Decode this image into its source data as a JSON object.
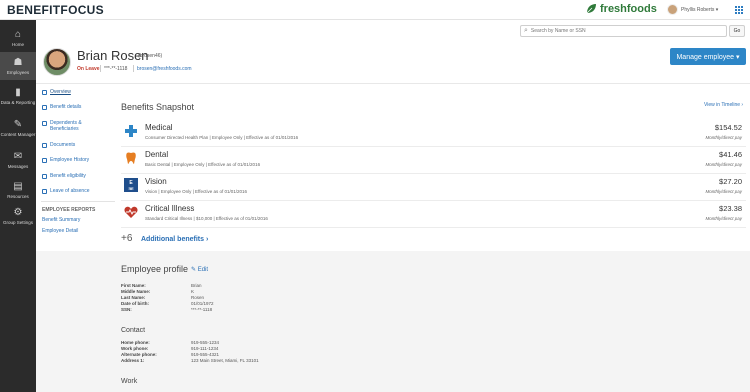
{
  "app": {
    "brand": "BENEFITFOCUS",
    "client_name": "freshfoods",
    "user_name": "Phyllis Roberts ▾",
    "search_placeholder": "Search by Name or SSN",
    "go_label": "Go"
  },
  "leftnav": [
    {
      "label": "Home",
      "icon": "home-icon",
      "glyph": "⌂"
    },
    {
      "label": "Employees",
      "icon": "employees-icon",
      "glyph": "☗",
      "active": true
    },
    {
      "label": "Data & Reporting",
      "icon": "chart-icon",
      "glyph": "▮"
    },
    {
      "label": "Content Manager",
      "icon": "pencil-icon",
      "glyph": "✎"
    },
    {
      "label": "Messages",
      "icon": "envelope-icon",
      "glyph": "✉"
    },
    {
      "label": "Resources",
      "icon": "book-icon",
      "glyph": "▤"
    },
    {
      "label": "Group Settings",
      "icon": "gear-icon",
      "glyph": "⚙"
    }
  ],
  "employee": {
    "name": "Brian Rosen",
    "username": "(brosen46)",
    "status": "On Leave",
    "ssn": "***-**-1118",
    "email": "brosen@freshfoods.com",
    "manage_label": "Manage employee ▾"
  },
  "subnav": {
    "items": [
      {
        "label": "Overview",
        "active": true
      },
      {
        "label": "Benefit details"
      },
      {
        "label": "Dependents & Beneficiaries"
      },
      {
        "label": "Documents"
      },
      {
        "label": "Employee History"
      },
      {
        "label": "Benefit eligibility"
      },
      {
        "label": "Leave of absence"
      }
    ],
    "reports_heading": "EMPLOYEE REPORTS",
    "reports": [
      "Benefit Summary",
      "Employee Detail"
    ]
  },
  "snapshot": {
    "title": "Benefits Snapshot",
    "timeline_link": "View in Timeline ›",
    "benefits": [
      {
        "name": "Medical",
        "desc": "Consumer Directed Health Plan | Employee Only | Effective as of 01/01/2016",
        "amount": "$154.52",
        "freq": "Monthly/direct pay",
        "icon": "medical-cross-icon",
        "color": "#2d86c7"
      },
      {
        "name": "Dental",
        "desc": "Basic Dental | Employee Only | Effective as of 01/01/2016",
        "amount": "$41.46",
        "freq": "Monthly/direct pay",
        "icon": "tooth-icon",
        "color": "#e67e22"
      },
      {
        "name": "Vision",
        "desc": "Vision | Employee Only | Effective as of 01/01/2016",
        "amount": "$27.20",
        "freq": "Monthly/direct pay",
        "icon": "eye-chart-icon",
        "color": "#1f4e8c"
      },
      {
        "name": "Critical Illness",
        "desc": "Standard Critical Illness | $10,000 | Effective as of 01/01/2016",
        "amount": "$23.38",
        "freq": "Monthly/direct pay",
        "icon": "heart-pulse-icon",
        "color": "#c0392b"
      }
    ],
    "more_count": "+6",
    "more_label": "Additional benefits ›"
  },
  "profile": {
    "title": "Employee profile",
    "edit_label": "✎ Edit",
    "fields": [
      {
        "label": "First Name:",
        "value": "Brian"
      },
      {
        "label": "Middle Name:",
        "value": "K"
      },
      {
        "label": "Last Name:",
        "value": "Rosen"
      },
      {
        "label": "Date of birth:",
        "value": "01/01/1972"
      },
      {
        "label": "SSN:",
        "value": "***-**-1118"
      }
    ],
    "contact_title": "Contact",
    "contact": [
      {
        "label": "Home phone:",
        "value": "919-555-1234"
      },
      {
        "label": "Work phone:",
        "value": "919-111-1234"
      },
      {
        "label": "Alternate phone:",
        "value": "919-555-4321"
      },
      {
        "label": "Address 1:",
        "value": "123 Main Street, Miami, FL 33101"
      }
    ],
    "work_title": "Work"
  }
}
